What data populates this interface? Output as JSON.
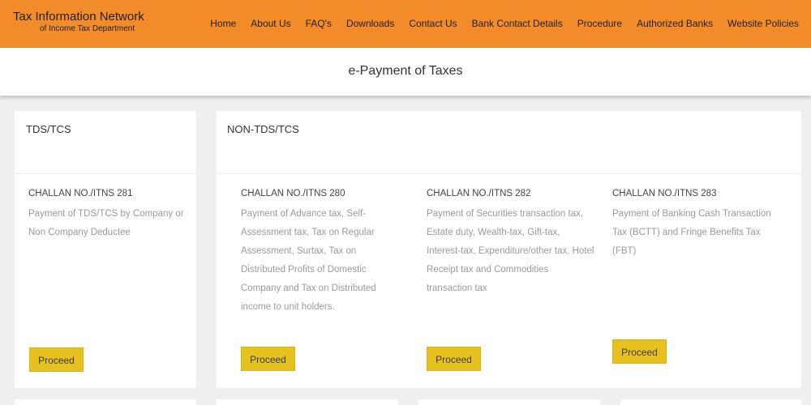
{
  "header": {
    "brand_title": "Tax Information Network",
    "brand_subtitle": "of Income Tax Department",
    "nav": [
      "Home",
      "About Us",
      "FAQ's",
      "Downloads",
      "Contact Us",
      "Bank Contact Details",
      "Procedure",
      "Authorized Banks",
      "Website Policies"
    ],
    "bg_color": "#f28c28"
  },
  "page_title": "e-Payment of Taxes",
  "tds_card": {
    "title": "TDS/TCS",
    "item": {
      "heading": "CHALLAN NO./ITNS 281",
      "description": "Payment of TDS/TCS by Company or Non Company Deductee",
      "button": "Proceed"
    }
  },
  "non_tds_card": {
    "title": "NON-TDS/TCS",
    "items": [
      {
        "heading": "CHALLAN NO./ITNS 280",
        "description": "Payment of Advance tax, Self-Assessment tax, Tax on Regular Assessment, Surtax, Tax on Distributed Profits of Domestic Company and Tax on Distributed income to unit holders.",
        "button": "Proceed"
      },
      {
        "heading": "CHALLAN NO./ITNS 282",
        "description": "Payment of Securities transaction tax, Estate duty, Wealth-tax, Gift-tax, Interest-tax, Expenditure/other tax, Hotel Receipt tax and Commodities transaction tax",
        "button": "Proceed"
      },
      {
        "heading": "CHALLAN NO./ITNS 283",
        "description": "Payment of Banking Cash Transaction Tax (BCTT) and Fringe Benefits Tax (FBT)",
        "button": "Proceed"
      }
    ]
  },
  "colors": {
    "button": "#e7c21f",
    "page_bg": "#efefef"
  }
}
